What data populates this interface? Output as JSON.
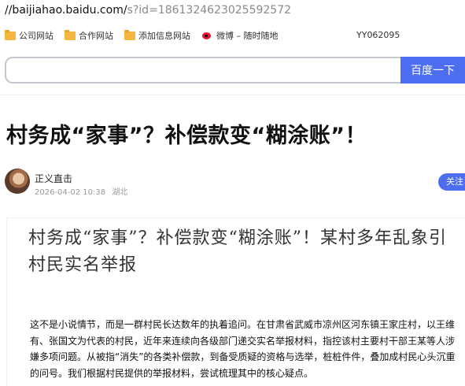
{
  "browser": {
    "url_host": "//baijiahao.baidu.com/",
    "url_path": "s?id=1861324623025592572"
  },
  "bookmarks": {
    "items": [
      {
        "label": "公司网站",
        "icon": "folder-icon"
      },
      {
        "label": "合作网站",
        "icon": "folder-icon"
      },
      {
        "label": "添加信息网站",
        "icon": "folder-icon"
      },
      {
        "label": "微博 – 随时随地",
        "icon": "weibo-icon"
      }
    ],
    "user_id": "YY062095"
  },
  "search": {
    "placeholder": "",
    "button_label": "百度一下"
  },
  "article": {
    "headline": "村务成“家事”？补偿款变“糊涂账”！",
    "author_name": "正义直击",
    "datetime": "2026-04-02 10:38",
    "location": "湖北",
    "follow_label": "关注"
  },
  "article_image": {
    "title": "村务成“家事”？补偿款变“糊涂账”！某村多年乱象引村民实名举报",
    "body": "这不是小说情节，而是一群村民长达数年的执着追问。在甘肃省武威市凉州区河东镇王家庄村，以王维有、张国文为代表的村民，近年来连续向各级部门递交实名举报材料，指控该村主要村干部王某等人涉嫌多项问题。从被指“消失”的各类补偿款，到备受质疑的资格与选举，桩桩件件，叠加成村民心头沉重的问号。我们根据村民提供的举报材料，尝试梳理其中的核心疑点。"
  },
  "colors": {
    "accent": "#4e6ef2",
    "folder": "#f4b63f",
    "weibo": "#e6162d"
  }
}
